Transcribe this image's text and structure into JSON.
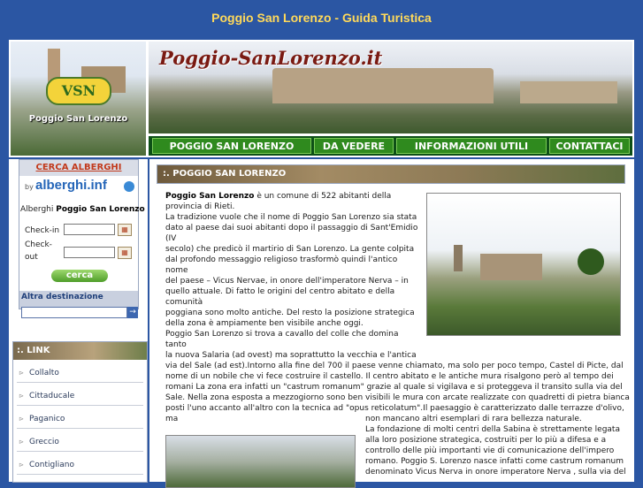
{
  "site_title": "Poggio San Lorenzo - Guida Turistica",
  "logo": {
    "badge": "VSN",
    "caption": "Poggio San Lorenzo"
  },
  "banner": {
    "title": "Poggio-SanLorenzo.it"
  },
  "nav": [
    {
      "label": "POGGIO SAN LORENZO"
    },
    {
      "label": "DA VEDERE"
    },
    {
      "label": "INFORMAZIONI UTILI"
    },
    {
      "label": "CONTATTACI"
    }
  ],
  "booking": {
    "header": "CERCA ALBERGHI",
    "by": "by",
    "brand": "alberghi.inf",
    "line_prefix": "Alberghi ",
    "line_place": "Poggio San Lorenzo",
    "checkin_label": "Check-in",
    "checkout_label_1": "Check-",
    "checkout_label_2": "out",
    "search_button": "cerca",
    "other_dest_label": "Altra destinazione",
    "go_glyph": "→"
  },
  "links": {
    "header": ":. LINK",
    "items": [
      "Collalto",
      "Cittaducale",
      "Paganico",
      "Greccio",
      "Contigliano"
    ]
  },
  "main": {
    "header": ":. POGGIO SAN LORENZO",
    "intro_bold": "Poggio San Lorenzo",
    "lines": [
      " è un comune di 522 abitanti della",
      "provincia di Rieti.",
      " La tradizione vuole che il nome di Poggio San Lorenzo sia stata",
      "dato al paese dai suoi abitanti dopo il passaggio di Sant'Emidio (IV",
      "secolo) che predicò il martirio di San Lorenzo. La gente colpita",
      "dal profondo messaggio religioso trasformò quindi l'antico nome",
      "del paese – Vicus Nervae, in onore dell'imperatore Nerva – in",
      "quello attuale. Di fatto le origini del centro abitato e della comunità",
      "poggiana sono molto antiche. Del resto la posizione strategica",
      "della zona è ampiamente ben visibile anche oggi.",
      " Poggio San Lorenzo si trova a cavallo del colle che domina tanto",
      "la nuova Salaria (ad ovest) ma soprattutto la vecchia e l'antica"
    ],
    "wide_lines": [
      "via del Sale (ad est).Intorno alla fine del 700 il paese venne chiamato, ma solo per poco tempo, Castel di Picte, dal",
      "nome di un nobile che vi fece costruire il castello. Il centro abitato e le antiche mura risalgono però al tempo dei",
      "romani La zona era infatti un \"castrum romanum\" grazie al quale si vigilava e si proteggeva il transito sulla via del",
      "Sale. Nella zona esposta a mezzogiorno sono ben visibili le mura con arcate realizzate con quadretti di pietra bianca",
      "posti l'uno accanto all'altro con la tecnica ad \"opus reticolatum\".Il paesaggio è caratterizzato dalle terrazze d'olivo, ma"
    ],
    "right_lines": [
      "non mancano altri esemplari di rara bellezza naturale.",
      "  La fondazione di molti centri della Sabina è strettamente legata",
      "alla loro posizione strategica, costruiti per lo più a difesa e a",
      "controllo delle più importanti vie di comunicazione dell'impero",
      "romano. Poggio S. Lorenzo nasce infatti come castrum romanum",
      "denominato Vicus Nerva in onore imperatore Nerva , sulla via del"
    ]
  }
}
